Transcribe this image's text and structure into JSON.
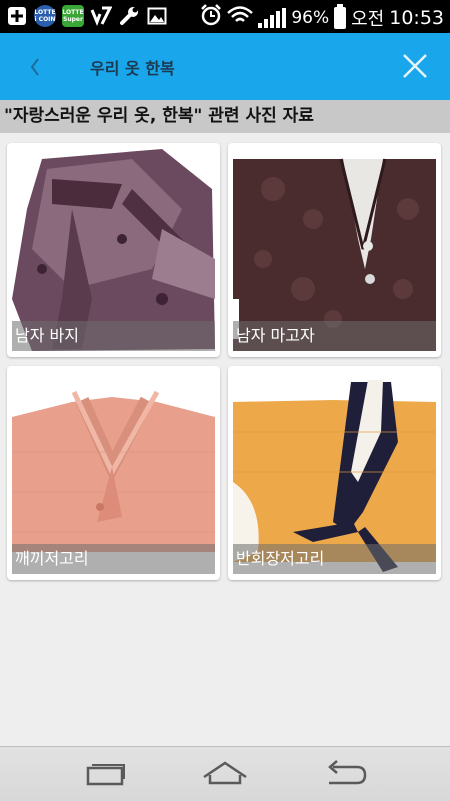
{
  "status_bar": {
    "battery_percent": "96%",
    "ampm": "오전",
    "time": "10:53",
    "apps": [
      {
        "name": "lotte-icoin-icon",
        "label": "LOTTE\ni COIN",
        "color": "#2a5fae"
      },
      {
        "name": "lotte-super-icon",
        "label": "LOTTE\nSuper",
        "color": "#3aa635"
      }
    ]
  },
  "header": {
    "title": "우리 옷 한복",
    "background": "#1aa6ea"
  },
  "section": {
    "title": "\"자랑스러운 우리 옷, 한복\" 관련 사진 자료"
  },
  "gallery": [
    {
      "caption": "남자 바지"
    },
    {
      "caption": "남자 마고자"
    },
    {
      "caption": "깨끼저고리"
    },
    {
      "caption": "반회장저고리"
    }
  ]
}
